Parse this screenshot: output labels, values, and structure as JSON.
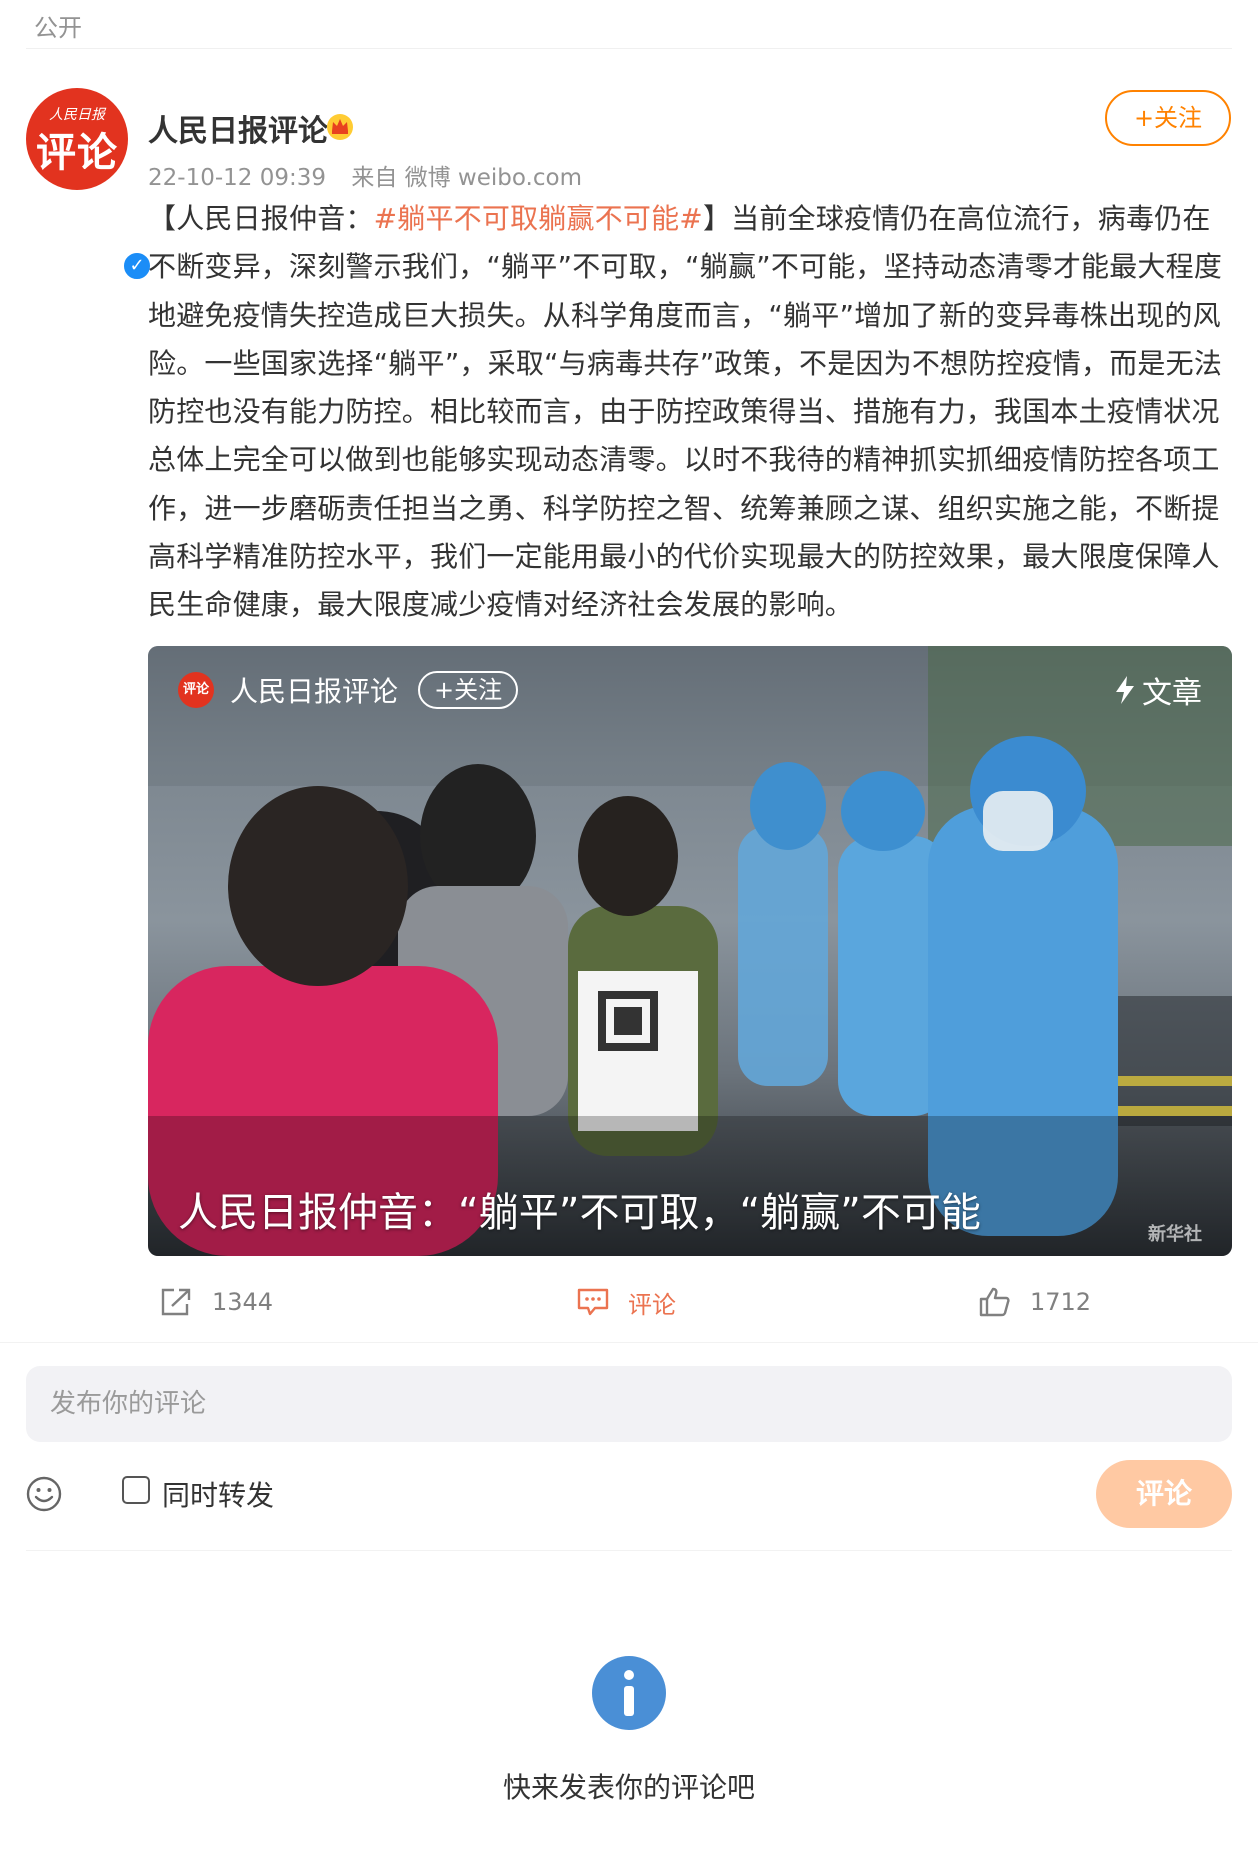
{
  "visibility": "公开",
  "post": {
    "author": "人民日报评论",
    "avatar_top": "人民日报",
    "avatar_main": "评论",
    "verified_mark": "✓",
    "date": "22-10-12 09:39",
    "source": "来自 微博 weibo.com",
    "follow_label": "+关注",
    "text_prefix": "【人民日报仲音：",
    "hashtag": "#躺平不可取躺赢不可能#",
    "text_body": "】当前全球疫情仍在高位流行，病毒仍在不断变异，深刻警示我们，“躺平”不可取，“躺赢”不可能，坚持动态清零才能最大程度地避免疫情失控造成巨大损失。从科学角度而言，“躺平”增加了新的变异毒株出现的风险。一些国家选择“躺平”，采取“与病毒共存”政策，不是因为不想防控疫情，而是无法防控也没有能力防控。相比较而言，由于防控政策得当、措施有力，我国本土疫情状况总体上完全可以做到也能够实现动态清零。以时不我待的精神抓实抓细疫情防控各项工作，进一步磨砺责任担当之勇、科学防控之智、统筹兼顾之谋、组织实施之能，不断提高科学精准防控水平，我们一定能用最小的代价实现最大的防控效果，最大限度保障人民生命健康，最大限度减少疫情对经济社会发展的影响。"
  },
  "card": {
    "avatar_text": "评论",
    "author": "人民日报评论",
    "follow_label": "+关注",
    "type_label": "文章",
    "title": "人民日报仲音：“躺平”不可取，“躺赢”不可能",
    "watermark": "新华社"
  },
  "actions": {
    "repost_count": "1344",
    "comment_label": "评论",
    "like_count": "1712"
  },
  "comment_box": {
    "placeholder": "发布你的评论",
    "repost_label": "同时转发",
    "submit_label": "评论"
  },
  "empty_state": {
    "message": "快来发表你的评论吧"
  },
  "colors": {
    "accent": "#ff8200",
    "link": "#eb7350",
    "brand_red": "#e2331f",
    "submit_disabled": "#ffc9a3",
    "info_blue": "#4a8fd6"
  }
}
